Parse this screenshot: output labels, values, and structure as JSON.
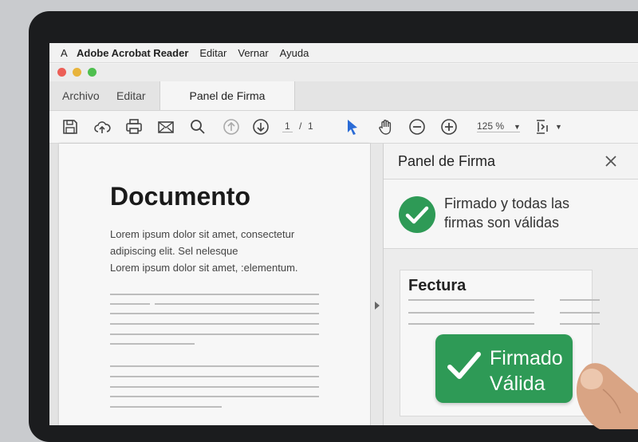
{
  "menubar": {
    "app_logo": "A",
    "app_name": "Adobe Acrobat Reader",
    "items": [
      "Editar",
      "Vernar",
      "Ayuda"
    ]
  },
  "window_controls": {
    "colors": [
      "#ec5f57",
      "#e8b43c",
      "#4fbf4f"
    ]
  },
  "tabs": {
    "items": [
      "Archivo",
      "Editar"
    ],
    "active": "Panel de Firma"
  },
  "toolbar": {
    "icons": [
      "save-icon",
      "cloud-upload-icon",
      "print-icon",
      "email-icon",
      "search-icon",
      "page-up-icon",
      "page-down-icon",
      "select-cursor-icon",
      "hand-tool-icon",
      "zoom-out-icon",
      "zoom-in-icon",
      "fit-page-icon"
    ],
    "page_current": "1",
    "page_separator": "/",
    "page_total": "1",
    "zoom": "125 %"
  },
  "document": {
    "title": "Documento",
    "lines": [
      "Lorem ipsum dolor sit amet, consectetur",
      "adipiscing elit. Sel nelesque",
      "Lorem ipsum dolor sit amet, :elementum."
    ]
  },
  "panel": {
    "title": "Panel de Firma",
    "close_icon": "close-icon",
    "status_line1": "Firmado y todas las",
    "status_line2": "firmas son válidas",
    "status_color": "#2e9a56",
    "card_title": "Fectura",
    "badge_line1": "Firmado",
    "badge_line2": "Válida",
    "badge_color": "#2e9a56"
  }
}
